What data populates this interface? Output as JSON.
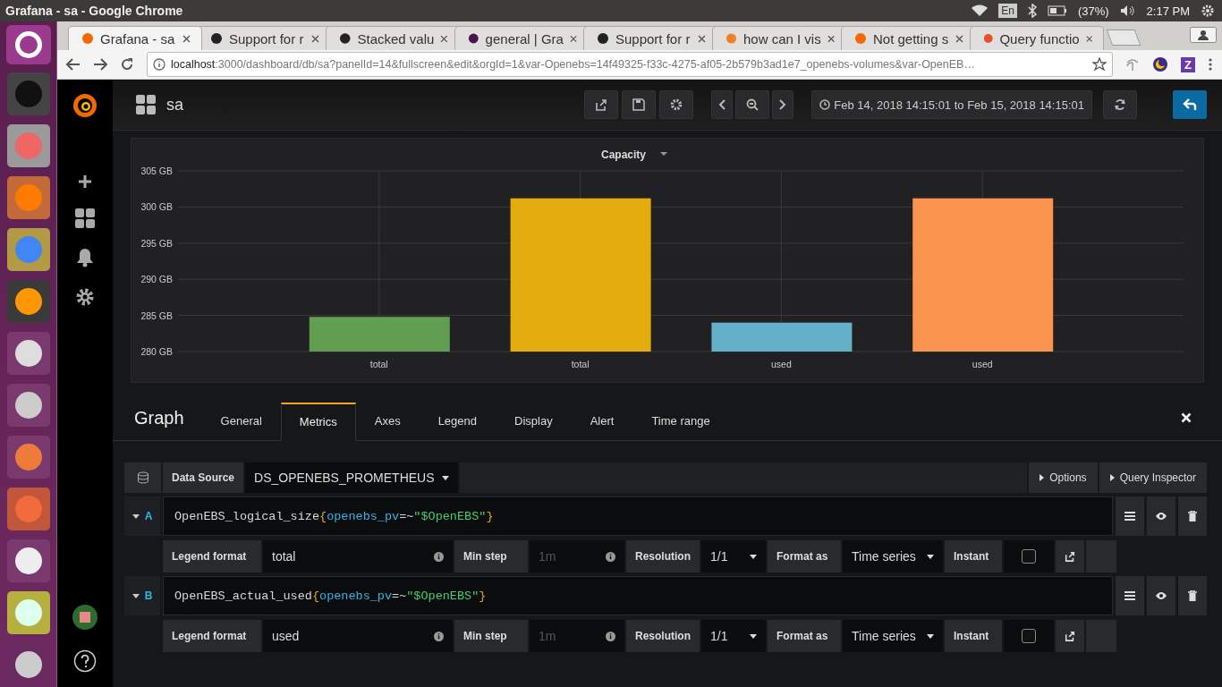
{
  "os_bar": {
    "title": "Grafana - sa - Google Chrome",
    "keyboard": "En",
    "battery": "(37%)",
    "time": "2:17 PM"
  },
  "browser": {
    "tabs": [
      {
        "label": "Grafana - sa",
        "kind": "grafana",
        "selected": true
      },
      {
        "label": "Support for r",
        "kind": "github",
        "selected": false
      },
      {
        "label": "Stacked valu",
        "kind": "github",
        "selected": false
      },
      {
        "label": "general | Gra",
        "kind": "hash",
        "selected": false
      },
      {
        "label": "Support for r",
        "kind": "github",
        "selected": false
      },
      {
        "label": "how can I vis",
        "kind": "stack",
        "selected": false
      },
      {
        "label": "Not getting s",
        "kind": "grafana",
        "selected": false
      },
      {
        "label": "Query functio",
        "kind": "flame",
        "selected": false
      }
    ],
    "url_host": "localhost",
    "url_rest": ":3000/dashboard/db/sa?panelId=14&fullscreen&edit&orgId=1&var-Openebs=14f49325-f33c-4275-af05-2b579b3ad1e7_openebs-volumes&var-OpenEB…",
    "extension_letter": "Z"
  },
  "dashboard": {
    "title": "sa",
    "time_range": "Feb 14, 2018 14:15:01 to Feb 15, 2018 14:15:01"
  },
  "panel": {
    "chart_data": {
      "type": "bar",
      "title": "Capacity",
      "grid": true,
      "series": [
        {
          "name": "total",
          "color": "#629e51",
          "values": [
            284.8,
            null,
            null,
            null
          ]
        },
        {
          "name": "total",
          "color": "#e5ac0e",
          "values": [
            null,
            301.2,
            null,
            null
          ]
        },
        {
          "name": "used",
          "color": "#64b0c8",
          "values": [
            null,
            null,
            284.0,
            null
          ]
        },
        {
          "name": "used",
          "color": "#f9934e",
          "values": [
            null,
            null,
            null,
            301.2
          ]
        }
      ],
      "ylim": [
        280,
        305
      ],
      "yticks": [
        {
          "value": 280,
          "label": "280 GB"
        },
        {
          "value": 285,
          "label": "285 GB"
        },
        {
          "value": 290,
          "label": "290 GB"
        },
        {
          "value": 295,
          "label": "295 GB"
        },
        {
          "value": 300,
          "label": "300 GB"
        },
        {
          "value": 305,
          "label": "305 GB"
        }
      ]
    }
  },
  "editor": {
    "title": "Graph",
    "tabs": [
      {
        "label": "General",
        "selected": false
      },
      {
        "label": "Metrics",
        "selected": true
      },
      {
        "label": "Axes",
        "selected": false
      },
      {
        "label": "Legend",
        "selected": false
      },
      {
        "label": "Display",
        "selected": false
      },
      {
        "label": "Alert",
        "selected": false
      },
      {
        "label": "Time range",
        "selected": false
      }
    ],
    "data_source_label": "Data Source",
    "data_source": "DS_OPENEBS_PROMETHEUS",
    "buttons": [
      "Options",
      "Query Inspector"
    ]
  },
  "queries": [
    {
      "ref": "A",
      "expr": [
        {
          "text": "OpenEBS_logical_size",
          "kind": "metric"
        },
        {
          "text": "{",
          "kind": "brace"
        },
        {
          "text": "openebs_pv",
          "kind": "label"
        },
        {
          "text": "=~",
          "kind": "op"
        },
        {
          "text": "\"$OpenEBS\"",
          "kind": "string"
        },
        {
          "text": "}",
          "kind": "brace"
        }
      ],
      "legend_label": "Legend format",
      "legend": "total",
      "min_step_label": "Min step",
      "min_step_placeholder": "1m",
      "resolution_label": "Resolution",
      "resolution": "1/1",
      "format_label": "Format as",
      "format": "Time series",
      "instant_label": "Instant",
      "instant": false
    },
    {
      "ref": "B",
      "expr": [
        {
          "text": "OpenEBS_actual_used",
          "kind": "metric"
        },
        {
          "text": "{",
          "kind": "brace"
        },
        {
          "text": "openebs_pv",
          "kind": "label"
        },
        {
          "text": "=~",
          "kind": "op"
        },
        {
          "text": "\"$OpenEBS\"",
          "kind": "string"
        },
        {
          "text": "}",
          "kind": "brace"
        }
      ],
      "legend_label": "Legend format",
      "legend": "used",
      "min_step_label": "Min step",
      "min_step_placeholder": "1m",
      "resolution_label": "Resolution",
      "resolution": "1/1",
      "format_label": "Format as",
      "format": "Time series",
      "instant_label": "Instant",
      "instant": false
    }
  ]
}
